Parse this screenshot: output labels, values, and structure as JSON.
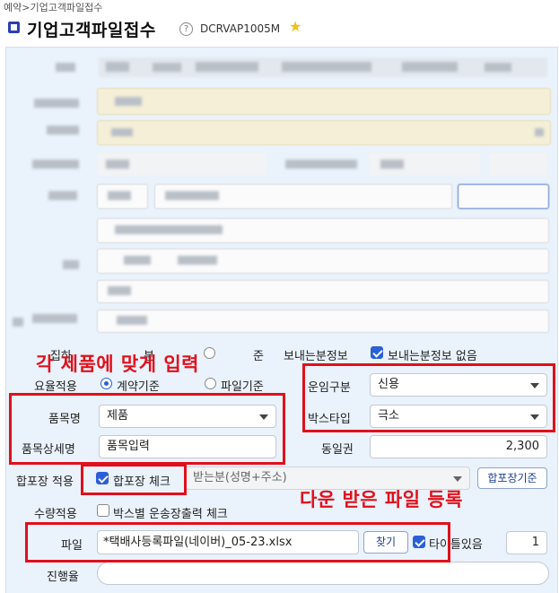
{
  "breadcrumb": "예약>기업고객파일접수",
  "header": {
    "title": "기업고객파일접수",
    "help_icon": "question-circle-icon",
    "screen_code": "DCRVAP1005M",
    "favorite_icon": "star-icon"
  },
  "form": {
    "partial_row": {
      "label_a": "집하",
      "label_b": "분",
      "label_c": "준",
      "sender_info_label": "보내는분정보",
      "no_sender_info_label": "보내는분정보 없음",
      "no_sender_info_checked": true
    },
    "rate_apply": {
      "label": "요율적용",
      "options": [
        "계약기준",
        "파일기준"
      ],
      "selected": "계약기준"
    },
    "freight_type": {
      "label": "운임구분",
      "value": "신용"
    },
    "item_name": {
      "label": "품목명",
      "value": "제품"
    },
    "box_type": {
      "label": "박스타입",
      "value": "극소"
    },
    "item_detail": {
      "label": "품목상세명",
      "value": "품목입력"
    },
    "same_day_zone": {
      "label": "동일권",
      "value": "2,300"
    },
    "combine_pack": {
      "label": "합포장 적용",
      "checkbox_label": "합포장 체크",
      "checked": true,
      "select_value": "받는분(성명+주소)",
      "criteria_button": "합포장기준"
    },
    "quantity_apply": {
      "label": "수량적용",
      "checkbox_label": "박스별 운송장출력 체크",
      "checked": false
    },
    "file": {
      "label": "파일",
      "value": "*택배사등록파일(네이버)_05-23.xlsx",
      "find_button": "찾기",
      "title_checkbox_label": "타이틀있음",
      "title_checked": true,
      "title_row_count": "1"
    },
    "progress": {
      "label": "진행율"
    }
  },
  "annotations": {
    "input_per_item": "각 제품에 맞게 입력",
    "register_downloaded_file": "다운 받은 파일 등록"
  },
  "colors": {
    "accent": "#2a5fd8",
    "annotation_red": "#e0101c",
    "panel_bg": "#eaf2fb",
    "title_square": "#2a3eb8",
    "star": "#f0c020"
  }
}
